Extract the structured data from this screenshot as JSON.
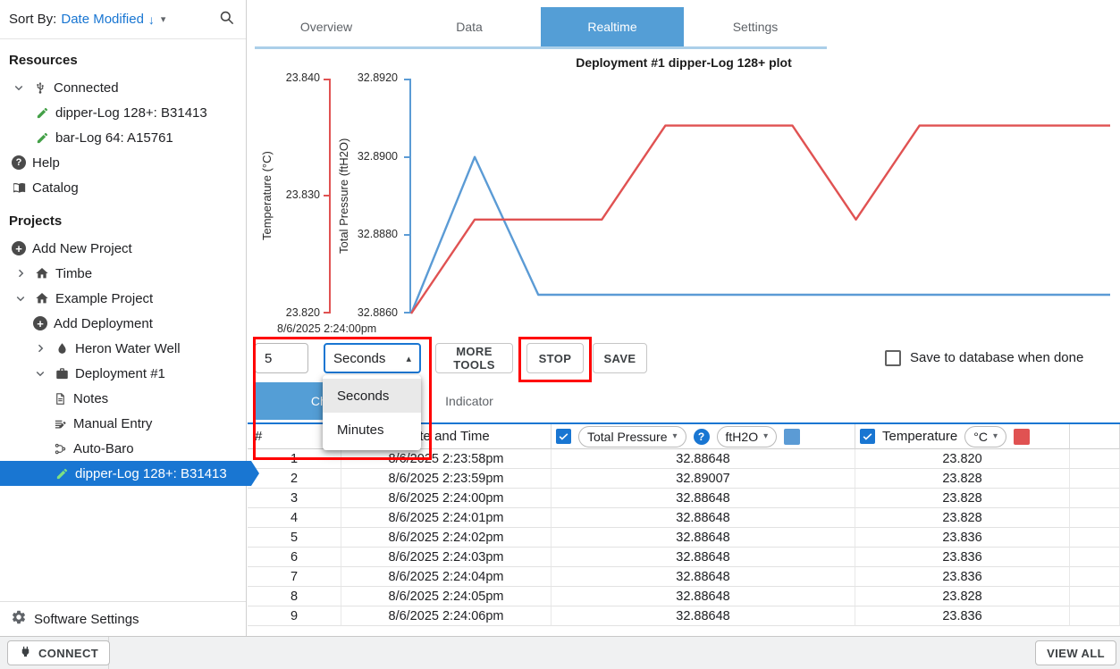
{
  "sidebar": {
    "sort_label": "Sort By:",
    "sort_value": "Date Modified",
    "resources_header": "Resources",
    "connected_label": "Connected",
    "device_dipper": "dipper-Log 128+: B31413",
    "device_bar": "bar-Log 64: A15761",
    "help_label": "Help",
    "catalog_label": "Catalog",
    "projects_header": "Projects",
    "add_new_project": "Add New Project",
    "project_timbe": "Timbe",
    "project_example": "Example Project",
    "add_deployment": "Add Deployment",
    "heron_water_well": "Heron Water Well",
    "deployment_1": "Deployment #1",
    "notes": "Notes",
    "manual_entry": "Manual Entry",
    "auto_baro": "Auto-Baro",
    "selected_device": "dipper-Log 128+: B31413",
    "software_settings": "Software Settings"
  },
  "tabs": [
    "Overview",
    "Data",
    "Realtime",
    "Settings"
  ],
  "subtabs": [
    "Chart",
    "Indicator"
  ],
  "chart_data": {
    "type": "line",
    "title": "Deployment #1 dipper-Log 128+ plot",
    "x_first_tick": "8/6/2025 2:24:00pm",
    "grid": false,
    "legend": false,
    "axes": [
      {
        "label": "Temperature (°C)",
        "ticks": [
          "23.840",
          "23.830",
          "23.820"
        ],
        "range": [
          23.82,
          23.84
        ],
        "color": "#e05252"
      },
      {
        "label": "Total Pressure (ftH2O)",
        "ticks": [
          "32.8920",
          "32.8900",
          "32.8880",
          "32.8860"
        ],
        "range": [
          32.886,
          32.892
        ],
        "color": "#5b9bd5"
      }
    ],
    "series": [
      {
        "name": "Total Pressure",
        "unit": "ftH2O",
        "color": "#5b9bd5",
        "ymin": 32.886,
        "ymax": 32.892,
        "values": [
          32.886,
          32.89,
          32.88648,
          32.88648,
          32.88648,
          32.88648,
          32.88648,
          32.88648,
          32.88648,
          32.88648,
          32.88648,
          32.88648
        ]
      },
      {
        "name": "Temperature",
        "unit": "°C",
        "color": "#e05252",
        "ymin": 23.82,
        "ymax": 23.84,
        "values": [
          23.82,
          23.828,
          23.828,
          23.828,
          23.836,
          23.836,
          23.836,
          23.828,
          23.836,
          23.836,
          23.836,
          23.836
        ]
      }
    ]
  },
  "controls": {
    "interval_value": "5",
    "interval_unit": "Seconds",
    "unit_options": [
      "Seconds",
      "Minutes"
    ],
    "more_tools_label": "MORE TOOLS",
    "stop_label": "STOP",
    "save_label": "SAVE",
    "save_to_db_label": "Save to database when done",
    "save_to_db_checked": false
  },
  "table": {
    "number_header": "#",
    "datetime_header": "Date and Time",
    "pressure_column": {
      "name": "Total Pressure",
      "unit": "ftH2O",
      "color": "#5b9bd5",
      "checked": true
    },
    "temperature_column": {
      "name": "Temperature",
      "unit": "°C",
      "color": "#e05252",
      "checked": true
    },
    "rows": [
      {
        "n": "1",
        "datetime": "8/6/2025 2:23:58pm",
        "pressure": "32.88648",
        "temperature": "23.820"
      },
      {
        "n": "2",
        "datetime": "8/6/2025 2:23:59pm",
        "pressure": "32.89007",
        "temperature": "23.828"
      },
      {
        "n": "3",
        "datetime": "8/6/2025 2:24:00pm",
        "pressure": "32.88648",
        "temperature": "23.828"
      },
      {
        "n": "4",
        "datetime": "8/6/2025 2:24:01pm",
        "pressure": "32.88648",
        "temperature": "23.828"
      },
      {
        "n": "5",
        "datetime": "8/6/2025 2:24:02pm",
        "pressure": "32.88648",
        "temperature": "23.836"
      },
      {
        "n": "6",
        "datetime": "8/6/2025 2:24:03pm",
        "pressure": "32.88648",
        "temperature": "23.836"
      },
      {
        "n": "7",
        "datetime": "8/6/2025 2:24:04pm",
        "pressure": "32.88648",
        "temperature": "23.836"
      },
      {
        "n": "8",
        "datetime": "8/6/2025 2:24:05pm",
        "pressure": "32.88648",
        "temperature": "23.828"
      },
      {
        "n": "9",
        "datetime": "8/6/2025 2:24:06pm",
        "pressure": "32.88648",
        "temperature": "23.836"
      }
    ]
  },
  "footer": {
    "connect_label": "CONNECT",
    "view_all_label": "VIEW ALL"
  },
  "icons": {
    "caret_down": "▾",
    "caret_up": "▴",
    "sort_descending": "↓",
    "help_glyph": "?",
    "plus_glyph": "+",
    "question_glyph": "?"
  }
}
